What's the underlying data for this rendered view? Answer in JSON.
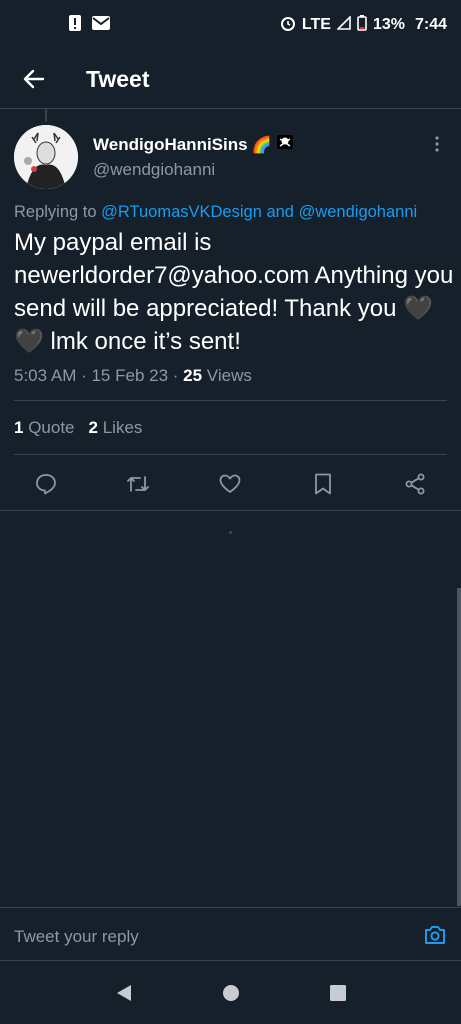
{
  "status_bar": {
    "network": "LTE",
    "battery": "13%",
    "time": "7:44",
    "icons": [
      "alert-icon",
      "mail-icon",
      "alarm-icon",
      "signal-icon",
      "battery-icon"
    ]
  },
  "header": {
    "title": "Tweet"
  },
  "tweet": {
    "display_name": "WendigoHanniSins",
    "name_emojis": "🌈",
    "handle": "@wendgiohanni",
    "replying_prefix": "Replying to ",
    "mention_1": "@RTuomasVKDesign",
    "mention_joiner": " and ",
    "mention_2": "@wendigohanni",
    "text_main": "My paypal email is newerldorder7@yahoo.com Anything you send will be appreciated! Thank you ",
    "text_hearts": "🖤🖤",
    "text_end": " lmk once it’s sent!",
    "time": "5:03 AM · 15 Feb 23 · ",
    "views_count": "25",
    "views_label": " Views"
  },
  "stats": {
    "quote_count": "1",
    "quote_label": " Quote",
    "likes_count": "2",
    "likes_label": " Likes"
  },
  "actions": [
    "reply-icon",
    "retweet-icon",
    "like-icon",
    "bookmark-icon",
    "share-icon"
  ],
  "reply_bar": {
    "placeholder": "Tweet your reply"
  },
  "colors": {
    "background": "#15202b",
    "accent": "#1d9bf0",
    "muted": "#8b98a5",
    "divider": "#38444d"
  }
}
